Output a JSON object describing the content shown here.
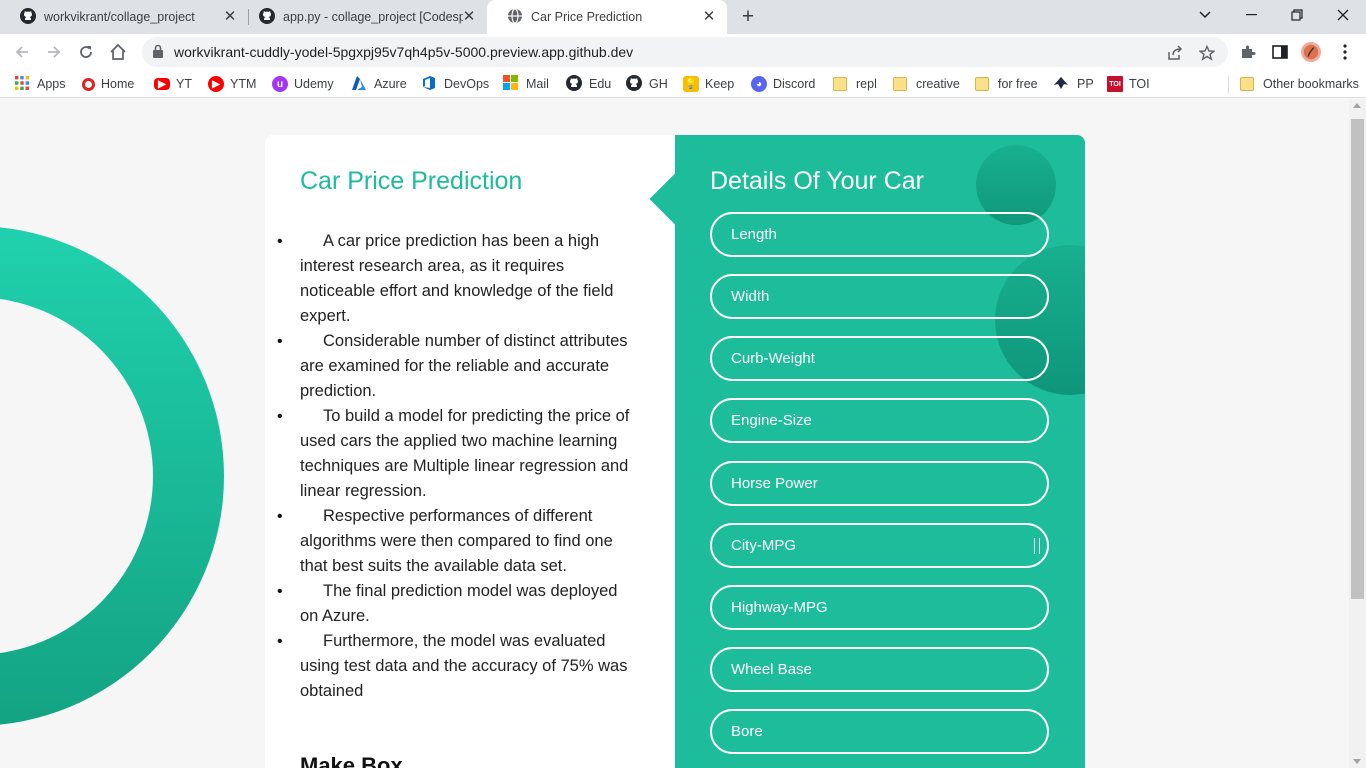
{
  "browser": {
    "tabs": [
      {
        "title": "workvikrant/collage_project",
        "icon": "github-icon"
      },
      {
        "title": "app.py - collage_project [Codesp",
        "icon": "github-icon"
      },
      {
        "title": "Car Price Prediction",
        "icon": "globe-icon"
      }
    ],
    "new_tab": "+",
    "url": "workvikrant-cuddly-yodel-5pgxpj95v7qh4p5v-5000.preview.app.github.dev",
    "bookmarks": [
      {
        "label": "Apps",
        "icon": "apps-grid-icon"
      },
      {
        "label": "Home",
        "icon": "opera-icon"
      },
      {
        "label": "YT",
        "icon": "youtube-icon"
      },
      {
        "label": "YTM",
        "icon": "youtube-music-icon"
      },
      {
        "label": "Udemy",
        "icon": "udemy-icon"
      },
      {
        "label": "Azure",
        "icon": "azure-icon"
      },
      {
        "label": "DevOps",
        "icon": "devops-icon"
      },
      {
        "label": "Mail",
        "icon": "microsoft-icon"
      },
      {
        "label": "Edu",
        "icon": "github-icon"
      },
      {
        "label": "GH",
        "icon": "github-icon"
      },
      {
        "label": "Keep",
        "icon": "keep-icon"
      },
      {
        "label": "Discord",
        "icon": "discord-icon"
      },
      {
        "label": "repl",
        "icon": "folder-icon"
      },
      {
        "label": "creative",
        "icon": "folder-icon"
      },
      {
        "label": "for free",
        "icon": "folder-icon"
      },
      {
        "label": "PP",
        "icon": "pp-icon"
      },
      {
        "label": "TOI",
        "icon": "toi-icon"
      }
    ],
    "other_bookmarks": "Other bookmarks"
  },
  "page": {
    "left_title": "Car Price Prediction",
    "bullets": [
      "A car price prediction has been a high interest research area, as it requires noticeable effort and knowledge of the field expert.",
      "Considerable number of distinct attributes are examined for the reliable and accurate prediction.",
      "To build a model for predicting the price of used cars the applied two machine learning techniques are Multiple linear regression and linear regression.",
      "Respective performances of different algorithms were then compared to find one that best suits the available data set.",
      "The final prediction model was deployed on Azure.",
      "Furthermore, the model was evaluated using test data and the accuracy of 75% was obtained"
    ],
    "make_box_label": "Make Box",
    "right_title": "Details Of Your Car",
    "fields": [
      "Length",
      "Width",
      "Curb-Weight",
      "Engine-Size",
      "Horse Power",
      "City-MPG",
      "Highway-MPG",
      "Wheel Base",
      "Bore"
    ]
  },
  "colors": {
    "accent": "#1dbd9c",
    "ring_top": "#20d1ad",
    "ring_bottom": "#13a383"
  }
}
